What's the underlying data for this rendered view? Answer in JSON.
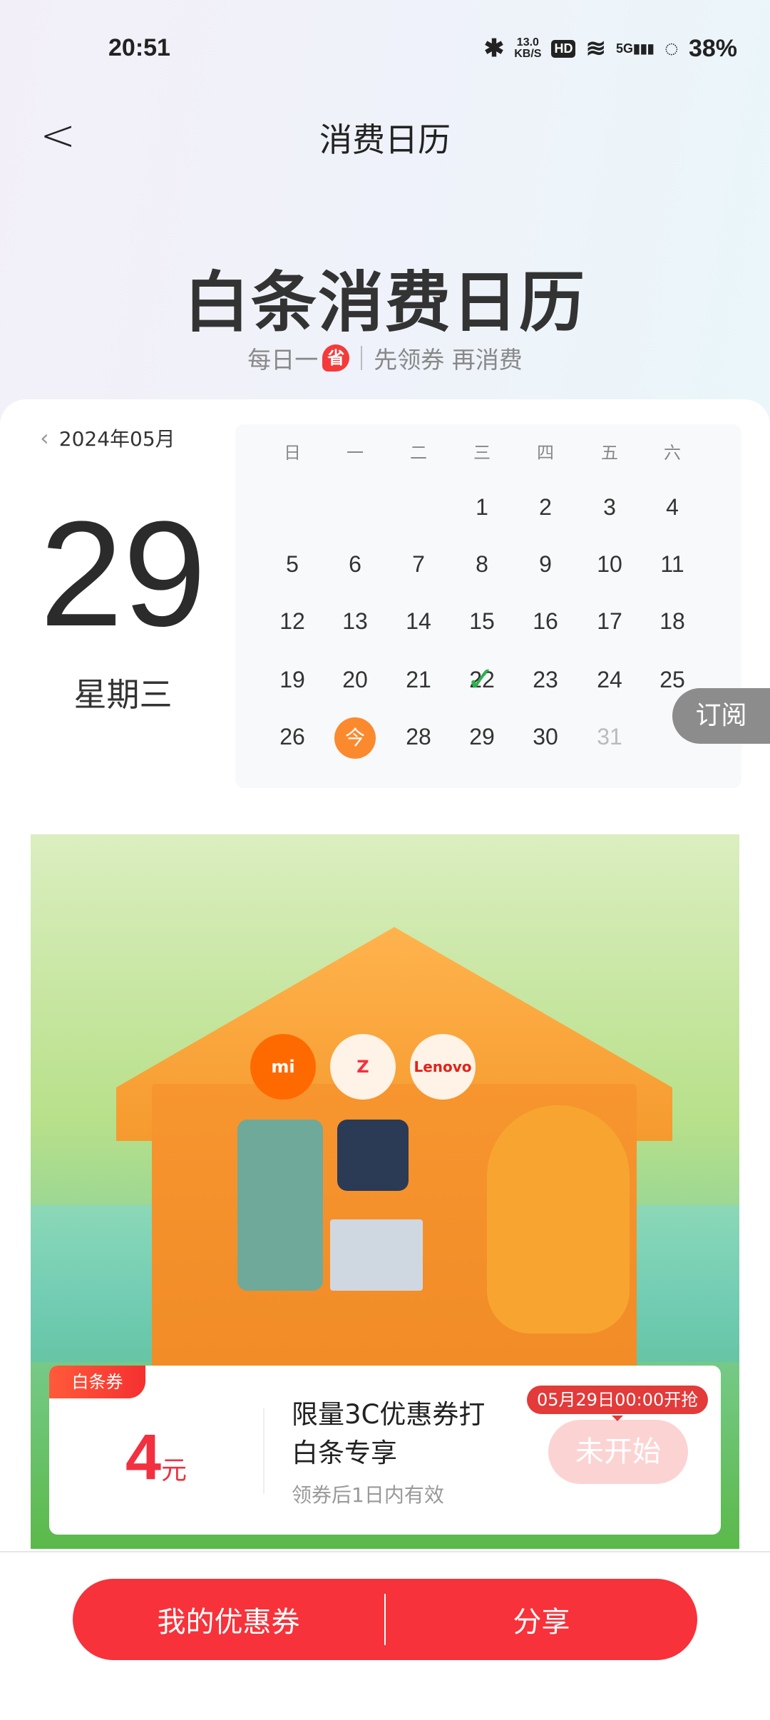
{
  "status": {
    "time": "20:51",
    "net_speed": "13.0",
    "net_unit": "KB/S",
    "hd": "HD",
    "network": "5G",
    "battery": "38%"
  },
  "nav": {
    "title": "消费日历"
  },
  "hero": {
    "title": "白条消费日历",
    "sub_a": "每日一",
    "sub_badge": "省",
    "sub_b": "先领券 再消费"
  },
  "calendar": {
    "month": "2024年05月",
    "day": "29",
    "weekday": "星期三",
    "headers": [
      "日",
      "一",
      "二",
      "三",
      "四",
      "五",
      "六"
    ],
    "rows": [
      [
        "",
        "",
        "",
        "1",
        "2",
        "3",
        "4"
      ],
      [
        "5",
        "6",
        "7",
        "8",
        "9",
        "10",
        "11"
      ],
      [
        "12",
        "13",
        "14",
        "15",
        "16",
        "17",
        "18"
      ],
      [
        "19",
        "20",
        "21",
        "22",
        "23",
        "24",
        "25"
      ],
      [
        "26",
        "今",
        "28",
        "29",
        "30",
        "31",
        ""
      ]
    ],
    "checked_day": "22",
    "today_label": "今",
    "disabled_day": "31"
  },
  "subscribe": "订阅",
  "banner": {
    "logos": [
      "mi",
      "",
      "Lenovo"
    ]
  },
  "coupon": {
    "tag": "白条券",
    "amount": "4",
    "unit": "元",
    "title": "限量3C优惠券打白条专享",
    "validity": "领券后1日内有效",
    "start_time": "05月29日00:00开抢",
    "status": "未开始"
  },
  "footer": {
    "my_coupons": "我的优惠券",
    "share": "分享"
  },
  "colors": {
    "accent": "#f7323a",
    "today": "#fb8a2e",
    "check": "#2ab24a"
  }
}
